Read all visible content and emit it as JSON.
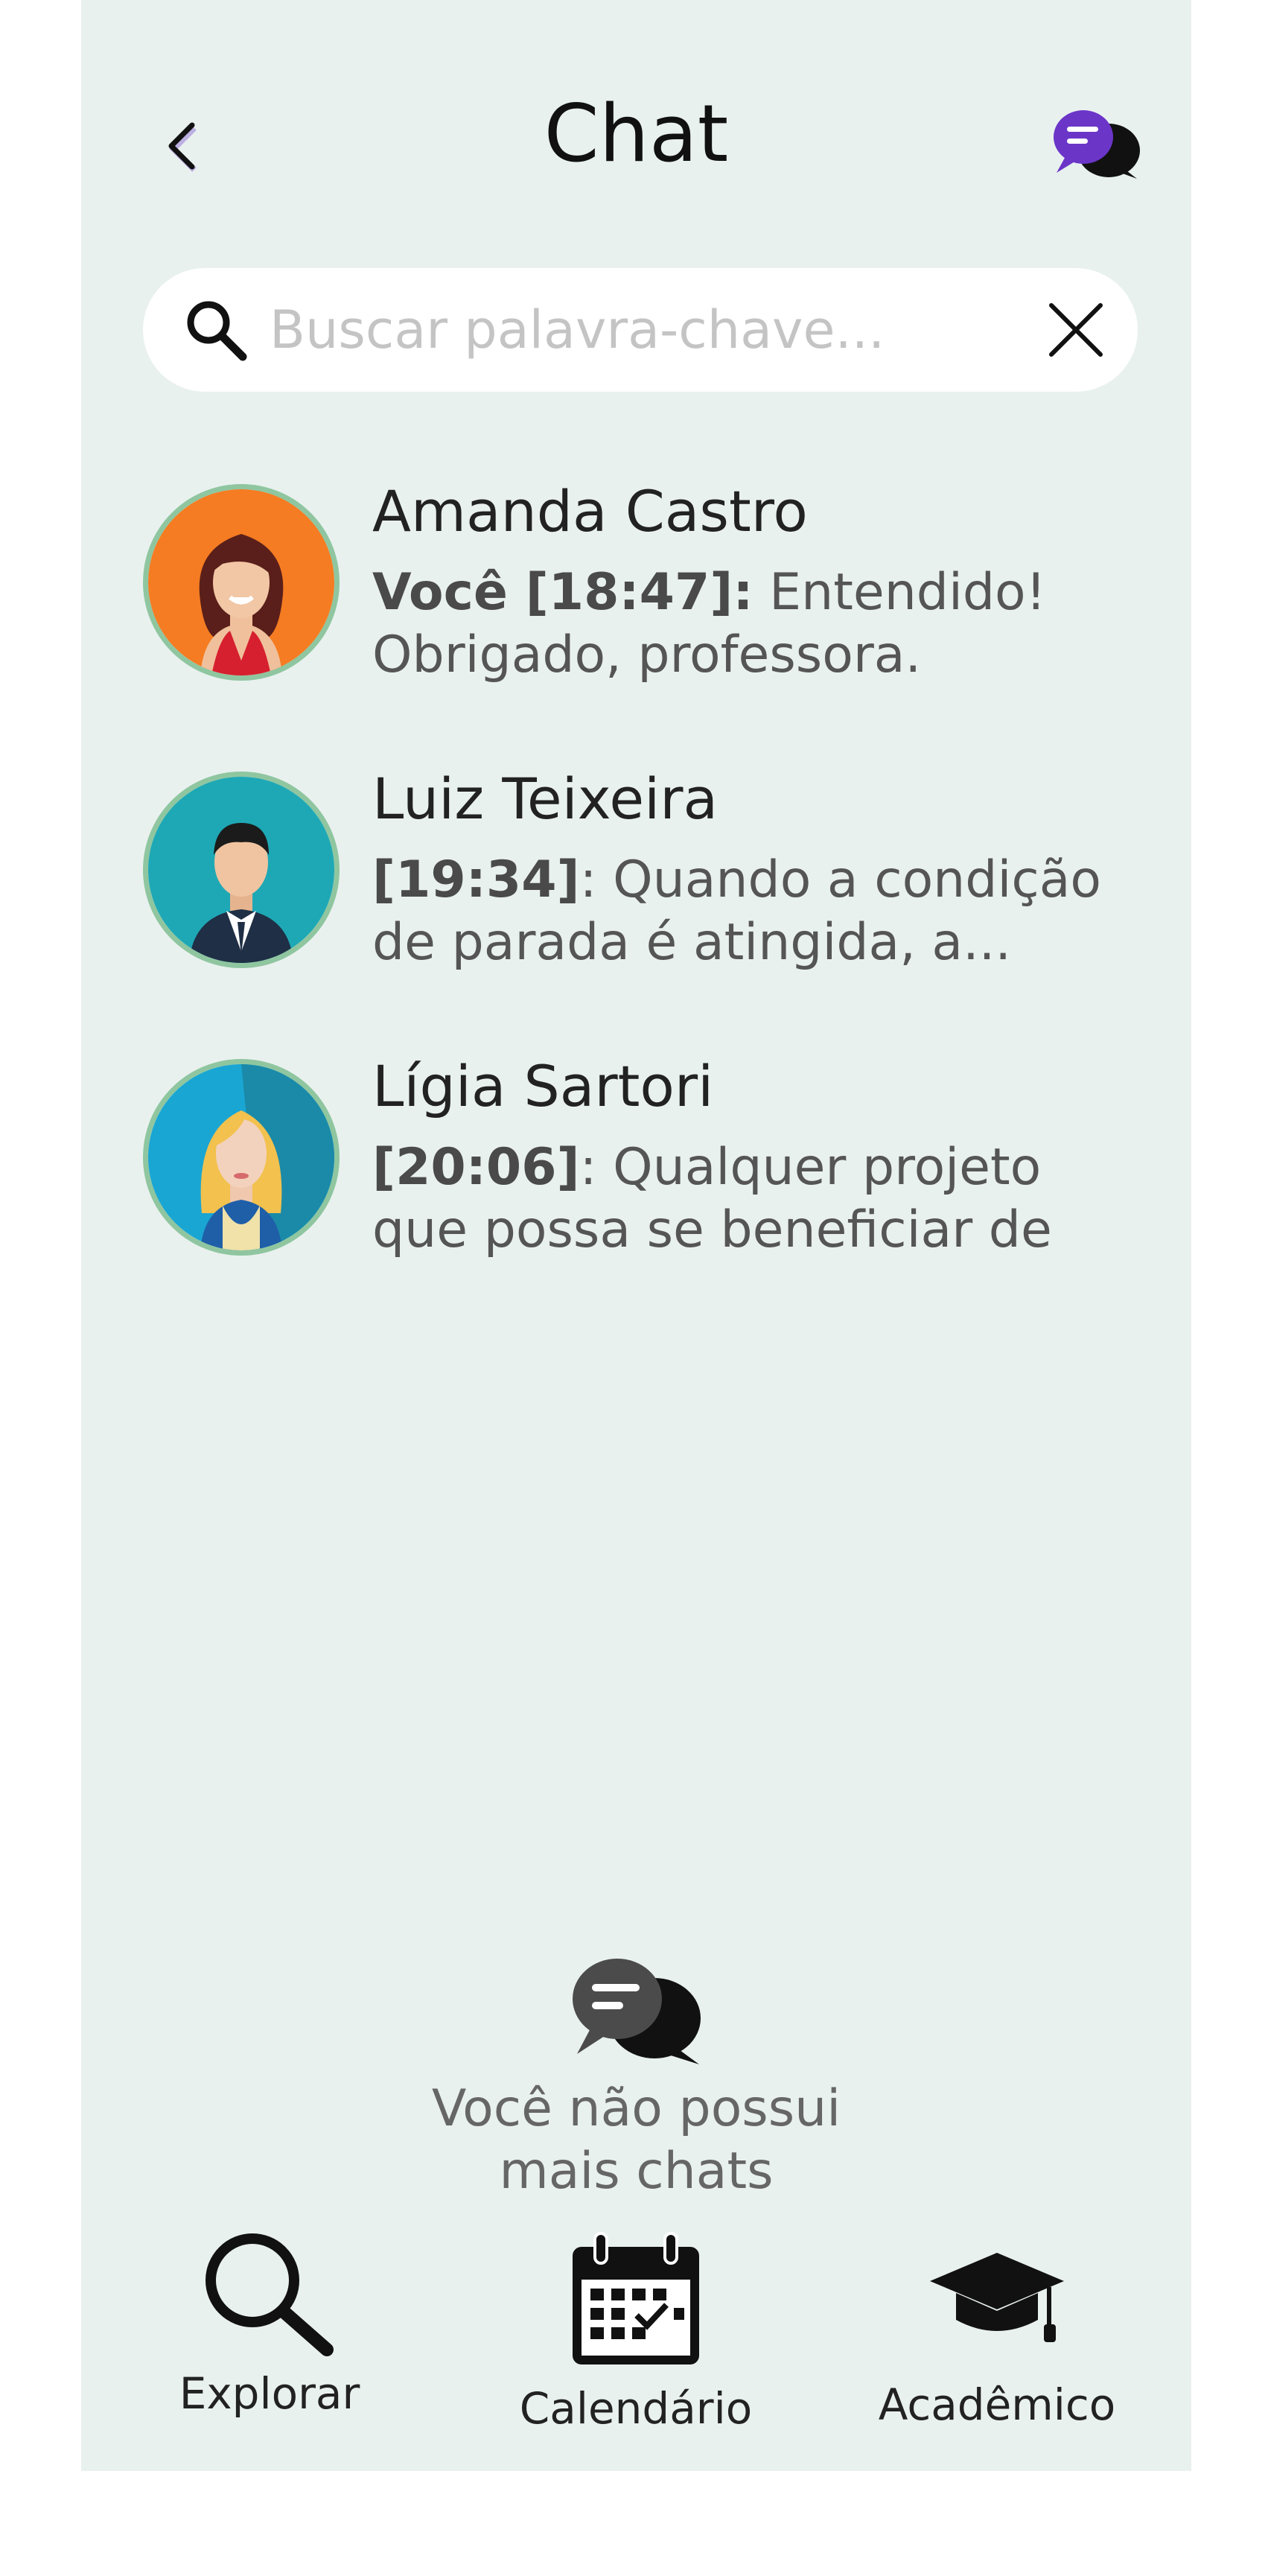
{
  "header": {
    "title": "Chat",
    "back_icon": "chevron-left-icon",
    "chat_icon": "chat-bubbles-icon",
    "accent_color": "#6b35c8"
  },
  "search": {
    "placeholder": "Buscar palavra-chave...",
    "value": "",
    "search_icon": "search-icon",
    "clear_icon": "close-icon"
  },
  "chats": [
    {
      "name": "Amanda Castro",
      "sender": "Você [18:47]:",
      "message": " Entendido! Obrigado, professora.",
      "avatar_color": "#f57c22"
    },
    {
      "name": "Luiz Teixeira",
      "sender": "[19:34]",
      "message": ": Quando a condição de parada é atingida, a...",
      "avatar_color": "#1ea8b5"
    },
    {
      "name": "Lígia Sartori",
      "sender": "[20:06]",
      "message": ": Qualquer projeto que possa se beneficiar de u...",
      "avatar_color": "#1aa6d3"
    }
  ],
  "empty_state": {
    "line1": "Você não possui",
    "line2": "mais chats",
    "icon": "chat-bubbles-icon"
  },
  "nav": [
    {
      "label": "Explorar",
      "icon": "search-icon"
    },
    {
      "label": "Calendário",
      "icon": "calendar-icon"
    },
    {
      "label": "Acadêmico",
      "icon": "graduation-cap-icon"
    }
  ]
}
